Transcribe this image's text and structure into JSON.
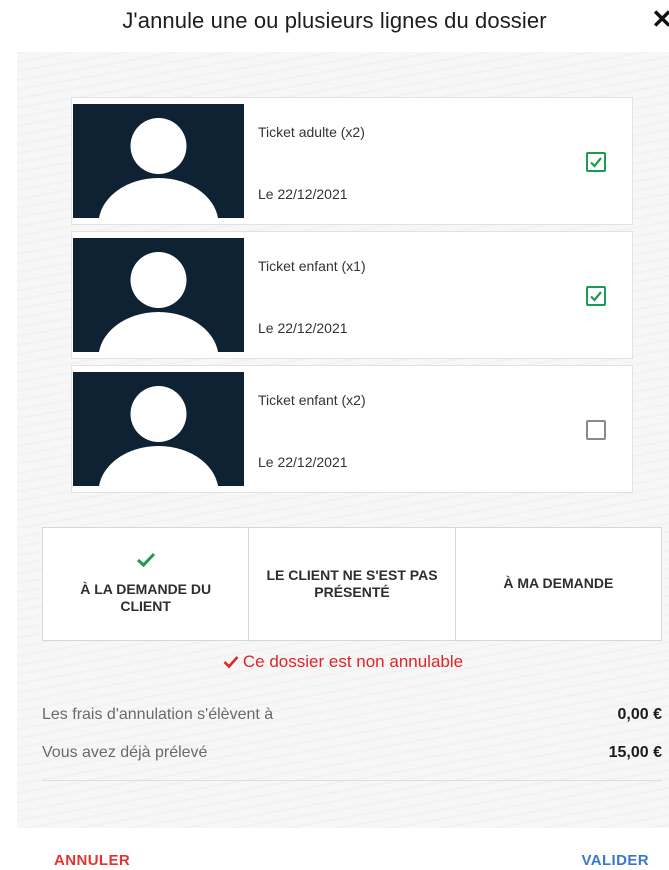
{
  "dialog": {
    "title": "J'annule une ou plusieurs lignes du dossier",
    "close_icon": "close-icon"
  },
  "tickets": [
    {
      "name": "Ticket adulte (x2)",
      "date": "Le 22/12/2021",
      "checked": true
    },
    {
      "name": "Ticket enfant (x1)",
      "date": "Le 22/12/2021",
      "checked": true
    },
    {
      "name": "Ticket enfant (x2)",
      "date": "Le 22/12/2021",
      "checked": false
    }
  ],
  "reasons": [
    {
      "label": "À LA DEMANDE DU CLIENT",
      "selected": true
    },
    {
      "label": "LE CLIENT NE S'EST PAS PRÉSENTÉ",
      "selected": false
    },
    {
      "label": "À MA DEMANDE",
      "selected": false
    }
  ],
  "warning": "Ce dossier est non annulable",
  "fees": {
    "cancellation_label": "Les frais d'annulation s'élèvent à",
    "cancellation_value": "0,00 €",
    "collected_label": "Vous avez déjà prélevé",
    "collected_value": "15,00 €"
  },
  "footer": {
    "cancel_label": "ANNULER",
    "validate_label": "VALIDER"
  },
  "colors": {
    "accent_green": "#1f9a52",
    "danger_red": "#e02424",
    "link_blue": "#3a79c9",
    "thumb_bg": "#0e2233"
  }
}
